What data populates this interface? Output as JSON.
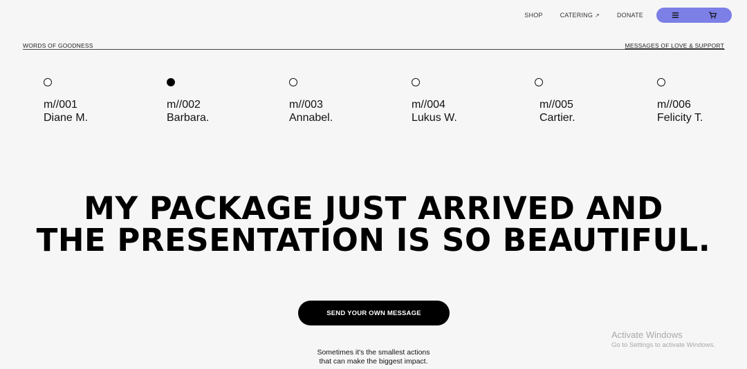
{
  "nav": {
    "links": [
      "SHOP",
      "CATERING",
      "DONATE"
    ],
    "catering_icon": "arrow-up-right-icon",
    "pill_color": "#7b7fe6",
    "menu_icon": "hamburger-menu-icon",
    "cart_icon": "shopping-cart-icon"
  },
  "header": {
    "left": "WORDS OF GOODNESS",
    "right": "MESSAGES OF LOVE & SUPPORT"
  },
  "messages": {
    "selected_index": 1,
    "items": [
      {
        "code": "m//001",
        "name": "Diane M."
      },
      {
        "code": "m//002",
        "name": "Barbara."
      },
      {
        "code": "m//003",
        "name": "Annabel."
      },
      {
        "code": "m//004",
        "name": "Lukus W."
      },
      {
        "code": "m//005",
        "name": "Cartier."
      },
      {
        "code": "m//006",
        "name": "Felicity T."
      }
    ]
  },
  "headline": {
    "line1": "MY PACKAGE JUST ARRIVED AND",
    "line2": "THE PRESENTATION IS SO BEAUTIFUL."
  },
  "cta": {
    "label": "SEND YOUR OWN MESSAGE"
  },
  "tagline": {
    "line1": "Sometimes it's the smallest actions",
    "line2": "that can make the biggest impact."
  },
  "watermark": {
    "title": "Activate Windows",
    "subtitle": "Go to Settings to activate Windows."
  }
}
